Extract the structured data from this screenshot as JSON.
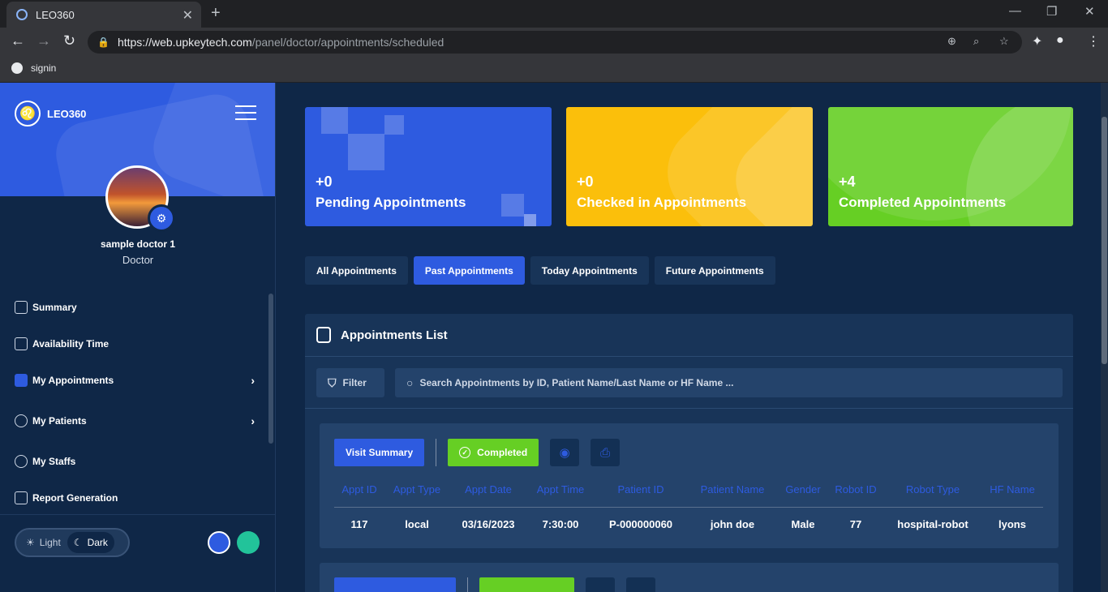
{
  "browser": {
    "tab_title": "LEO360",
    "url_host": "https://web.upkeytech.com",
    "url_path": "/panel/doctor/appointments/scheduled",
    "bookmark": "signin"
  },
  "sidebar": {
    "brand": "LEO360",
    "doctor_name": "sample doctor 1",
    "doctor_role": "Doctor",
    "items": [
      {
        "label": "Summary",
        "icon": "chart-icon"
      },
      {
        "label": "Availability Time",
        "icon": "calendar-icon"
      },
      {
        "label": "My Appointments",
        "icon": "appointments-icon"
      },
      {
        "label": "My Patients",
        "icon": "patients-icon"
      },
      {
        "label": "My Staffs",
        "icon": "staffs-icon"
      },
      {
        "label": "Report Generation",
        "icon": "report-icon"
      }
    ],
    "theme": {
      "light": "Light",
      "dark": "Dark",
      "selected": "Dark"
    },
    "swatches": [
      "#2e5be0",
      "#22c39a"
    ]
  },
  "stats": [
    {
      "count": "+0",
      "label": "Pending Appointments",
      "color": "#2e5be0"
    },
    {
      "count": "+0",
      "label": "Checked in Appointments",
      "color": "#fbbf0b"
    },
    {
      "count": "+4",
      "label": "Completed Appointments",
      "color": "#66cf24"
    }
  ],
  "tabs": [
    "All Appointments",
    "Past Appointments",
    "Today Appointments",
    "Future Appointments"
  ],
  "active_tab": "Past Appointments",
  "list": {
    "title": "Appointments List",
    "filter_label": "Filter",
    "search_placeholder": "Search Appointments by ID, Patient Name/Last Name or HF Name  ...",
    "columns": [
      "Appt ID",
      "Appt Type",
      "Appt Date",
      "Appt Time",
      "Patient ID",
      "Patient Name",
      "Gender",
      "Robot ID",
      "Robot Type",
      "HF Name"
    ],
    "records": [
      {
        "visit_label": "Visit Summary",
        "status_label": "Completed",
        "values": [
          "117",
          "local",
          "03/16/2023",
          "7:30:00",
          "P-000000060",
          "john doe",
          "Male",
          "77",
          "hospital-robot",
          "lyons"
        ]
      }
    ]
  }
}
